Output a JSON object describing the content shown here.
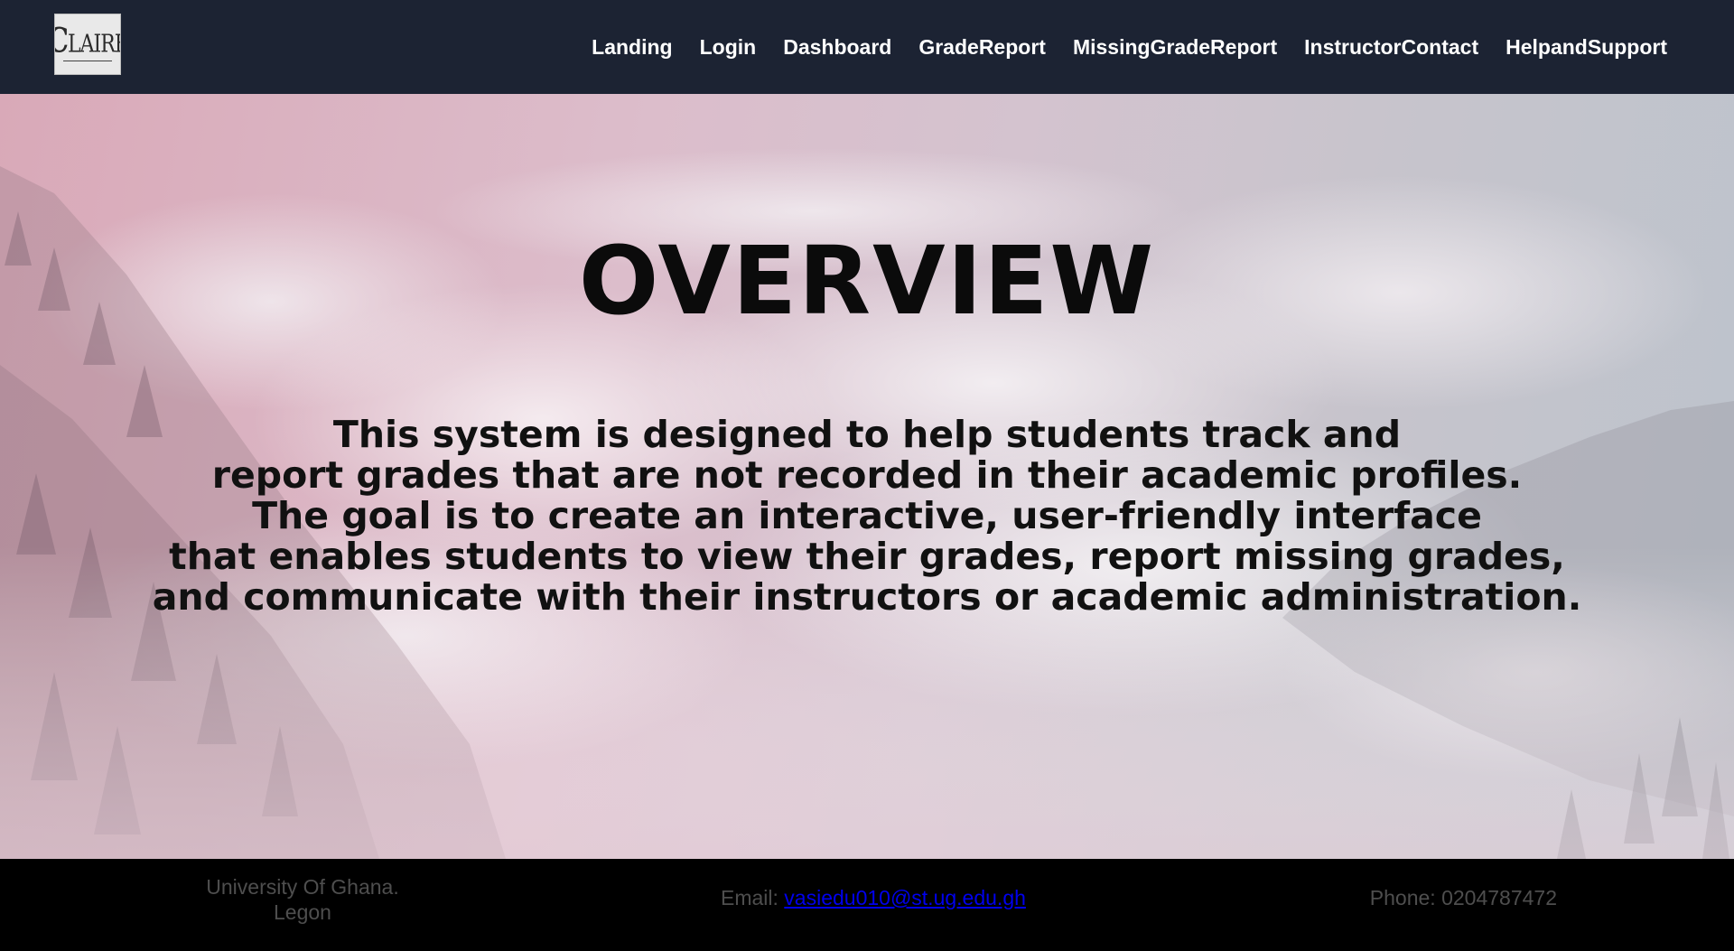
{
  "navbar": {
    "logo_text": "CLAIRE",
    "links": [
      {
        "label": "Landing"
      },
      {
        "label": "Login"
      },
      {
        "label": "Dashboard"
      },
      {
        "label": "GradeReport"
      },
      {
        "label": "MissingGradeReport"
      },
      {
        "label": "InstructorContact"
      },
      {
        "label": "HelpandSupport"
      }
    ]
  },
  "hero": {
    "title": "OVERVIEW",
    "description_lines": [
      "This system is designed to help students track and",
      "report grades that are not recorded in their academic profiles.",
      "The goal is to create an interactive, user-friendly interface",
      "that enables students to view their grades, report missing grades,",
      "and communicate with their instructors or academic administration."
    ]
  },
  "footer": {
    "address_line1": "University Of Ghana.",
    "address_line2": "Legon",
    "email_label": "Email: ",
    "email": "vasiedu010@st.ug.edu.gh",
    "phone": "Phone: 0204787472"
  },
  "colors": {
    "navbar_bg": "#1c2333",
    "footer_bg": "#000000",
    "footer_text": "#4e4e4e",
    "link": "#0000ee"
  }
}
